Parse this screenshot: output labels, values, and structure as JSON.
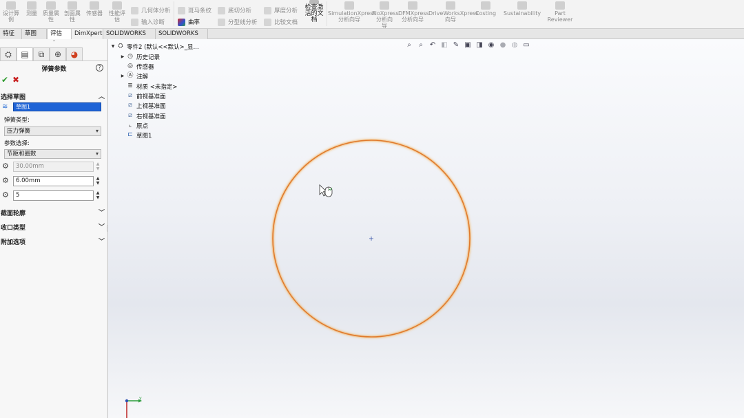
{
  "ribbon": {
    "col1": [
      "设计算",
      "例"
    ],
    "col2": "测量",
    "col3": [
      "质量属",
      "性"
    ],
    "col4": [
      "剖面属",
      "性"
    ],
    "col5": "传感器",
    "col6": [
      "性能评",
      "估"
    ],
    "small_col1": [
      "几何体分析",
      "输入诊断"
    ],
    "small_col2": [
      "斑马条纹",
      "曲率"
    ],
    "small_col3": [
      "底切分析",
      "分型线分析"
    ],
    "small_col4": [
      "厚度分析",
      "比较文档"
    ],
    "check_active": [
      "检查激",
      "活的文",
      "档"
    ],
    "sim": [
      "SimulationXpress",
      "分析向导"
    ],
    "flo": [
      "FloXpress",
      "分析向",
      "导"
    ],
    "dfm": [
      "DFMXpress",
      "分析向导"
    ],
    "drive": [
      "DriveWorksXpress",
      "向导"
    ],
    "costing": "Costing",
    "sustain": "Sustainability",
    "part": [
      "Part",
      "Reviewer"
    ]
  },
  "cmdtabs": [
    "特征",
    "草图",
    "评估",
    "DimXpert",
    "SOLIDWORKS 插件",
    "SOLIDWORKS MBD"
  ],
  "panel": {
    "title": "弹簧参数",
    "help": "?",
    "ok": "✔",
    "cancel": "✖",
    "grip": "⌃",
    "groups": {
      "select_sketch": "选择草图",
      "section_profile": "截面轮廓",
      "end_type": "收口类型",
      "additional": "附加选项"
    },
    "sketch_value": "草图1",
    "spring_type_label": "弹簧类型:",
    "spring_type_value": "压力弹簧",
    "param_label": "参数选择:",
    "param_value": "节距和圈数",
    "field1": "30.00mm",
    "field2": "6.00mm",
    "field3": "5"
  },
  "tree": {
    "root": "零件2 (默认<<默认>_显...",
    "history": "历史记录",
    "sensors": "传感器",
    "annotations": "注解",
    "material": "材质 <未指定>",
    "front": "前视基准面",
    "top": "上视基准面",
    "right": "右视基准面",
    "origin": "原点",
    "sketch": "草图1"
  },
  "colors": {
    "circle": "#e07a2c",
    "selection": "#1e63d6",
    "ok": "#2e9b2e",
    "cancel": "#c82020"
  },
  "triad": {
    "y": "Y"
  }
}
